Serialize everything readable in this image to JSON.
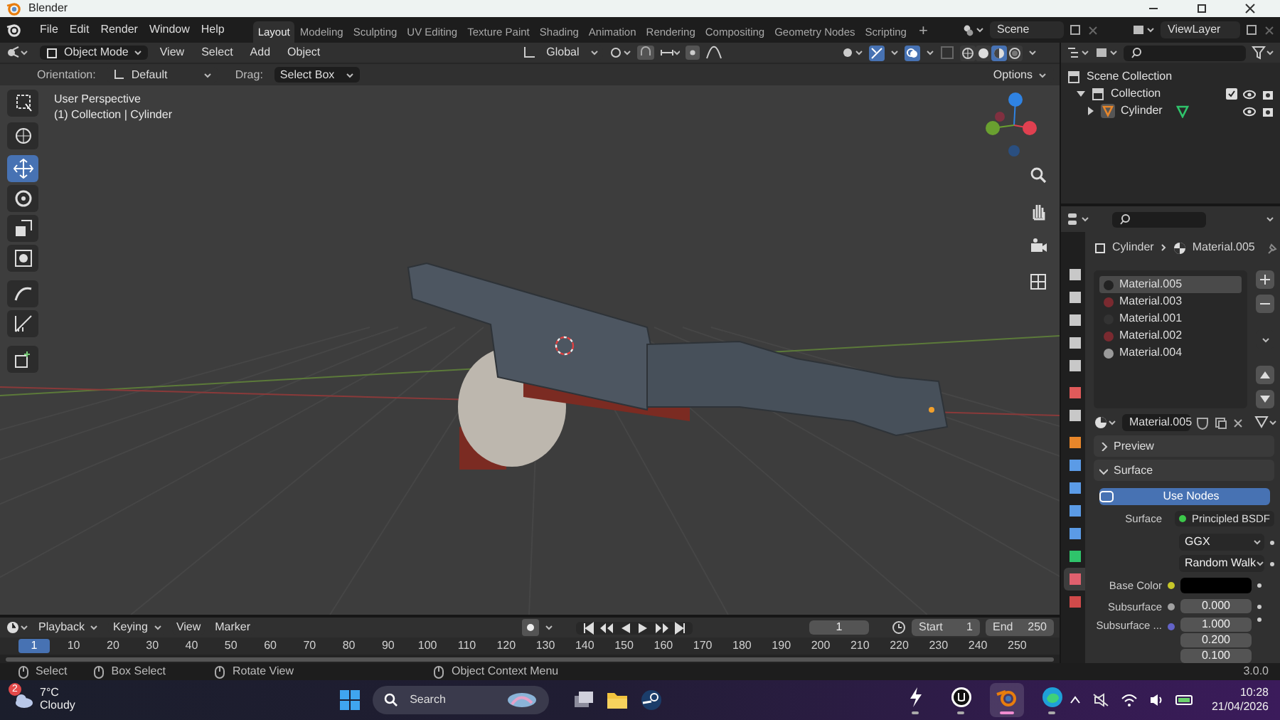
{
  "window": {
    "title": "Blender"
  },
  "menu": [
    "File",
    "Edit",
    "Render",
    "Window",
    "Help"
  ],
  "workspaces": [
    {
      "label": "Layout",
      "selected": true
    },
    {
      "label": "Modeling",
      "selected": false
    },
    {
      "label": "Sculpting",
      "selected": false
    },
    {
      "label": "UV Editing",
      "selected": false
    },
    {
      "label": "Texture Paint",
      "selected": false
    },
    {
      "label": "Shading",
      "selected": false
    },
    {
      "label": "Animation",
      "selected": false
    },
    {
      "label": "Rendering",
      "selected": false
    },
    {
      "label": "Compositing",
      "selected": false
    },
    {
      "label": "Geometry Nodes",
      "selected": false
    },
    {
      "label": "Scripting",
      "selected": false
    }
  ],
  "add_workspace": "+",
  "scene": "Scene",
  "view_layer": "ViewLayer",
  "viewport": {
    "mode": "Object Mode",
    "menus": [
      "View",
      "Select",
      "Add",
      "Object"
    ],
    "transform_orientation": "Global",
    "tool_settings": [
      {
        "label": "Orientation:",
        "value": "Default"
      },
      {
        "label": "Drag:",
        "value": "Select Box"
      }
    ],
    "options": "Options",
    "view_name": "User Perspective",
    "context": "(1) Collection | Cylinder",
    "tools": [
      {
        "selected": false
      },
      {
        "selected": false
      },
      {
        "selected": true
      },
      {
        "selected": false
      },
      {
        "selected": false
      },
      {
        "selected": false
      },
      {
        "selected": false
      },
      {
        "selected": false
      },
      {
        "selected": false
      }
    ],
    "shading_modes": [
      {
        "selected": false
      },
      {
        "selected": false
      },
      {
        "selected": true
      },
      {
        "selected": false
      }
    ]
  },
  "outliner": {
    "tree": [
      {
        "label": "Scene Collection",
        "children": [
          {
            "label": "Collection",
            "expanded": true,
            "children": [
              {
                "label": "Cylinder",
                "expanded": false
              }
            ]
          }
        ]
      }
    ]
  },
  "properties": {
    "tabs": [
      {
        "color": "#c8c8c8",
        "selected": false
      },
      {
        "color": "#c8c8c8",
        "selected": false
      },
      {
        "color": "#c8c8c8",
        "selected": false
      },
      {
        "color": "#c8c8c8",
        "selected": false
      },
      {
        "color": "#c8c8c8",
        "selected": false
      },
      {
        "color": "#e05a5a",
        "selected": false
      },
      {
        "color": "#c8c8c8",
        "selected": false
      },
      {
        "color": "#e8862a",
        "selected": false
      },
      {
        "color": "#5b9be6",
        "selected": false
      },
      {
        "color": "#5b9be6",
        "selected": false
      },
      {
        "color": "#5b9be6",
        "selected": false
      },
      {
        "color": "#5b9be6",
        "selected": false
      },
      {
        "color": "#2fc46b",
        "selected": false
      },
      {
        "color": "#e0606e",
        "selected": true
      },
      {
        "color": "#d04a4a",
        "selected": false
      }
    ],
    "breadcrumb": [
      "Cylinder",
      "Material.005"
    ],
    "materials": [
      {
        "label": "Material.005",
        "color": "#222222",
        "selected": true
      },
      {
        "label": "Material.003",
        "color": "#7a2a30",
        "selected": false
      },
      {
        "label": "Material.001",
        "color": "#333333",
        "selected": false
      },
      {
        "label": "Material.002",
        "color": "#7a2a30",
        "selected": false
      },
      {
        "label": "Material.004",
        "color": "#9a9a9a",
        "selected": false
      }
    ],
    "material_name": "Material.005",
    "panels": [
      {
        "label": "Preview",
        "expanded": false
      },
      {
        "label": "Surface",
        "expanded": true
      }
    ],
    "use_nodes": "Use Nodes",
    "fields": [
      {
        "kind": "link",
        "label": "Surface",
        "value": "Principled BSDF"
      },
      {
        "kind": "dropdown",
        "value": "GGX"
      },
      {
        "kind": "dropdown",
        "value": "Random Walk"
      },
      {
        "kind": "swatch",
        "label": "Base Color",
        "color": "#000000"
      },
      {
        "kind": "number",
        "label": "Subsurface",
        "value": "0.000"
      },
      {
        "kind": "vector",
        "label": "Subsurface ...",
        "values": [
          "1.000",
          "0.200",
          "0.100"
        ]
      }
    ]
  },
  "timeline": {
    "menus": [
      "Playback",
      "Keying",
      "View",
      "Marker"
    ],
    "current_frame": "1",
    "start_label": "Start",
    "start": "1",
    "end_label": "End",
    "end": "250",
    "ruler": [
      {
        "label": "1",
        "selected": true
      },
      {
        "label": "10",
        "selected": false
      },
      {
        "label": "20",
        "selected": false
      },
      {
        "label": "30",
        "selected": false
      },
      {
        "label": "40",
        "selected": false
      },
      {
        "label": "50",
        "selected": false
      },
      {
        "label": "60",
        "selected": false
      },
      {
        "label": "70",
        "selected": false
      },
      {
        "label": "80",
        "selected": false
      },
      {
        "label": "90",
        "selected": false
      },
      {
        "label": "100",
        "selected": false
      },
      {
        "label": "110",
        "selected": false
      },
      {
        "label": "120",
        "selected": false
      },
      {
        "label": "130",
        "selected": false
      },
      {
        "label": "140",
        "selected": false
      },
      {
        "label": "150",
        "selected": false
      },
      {
        "label": "160",
        "selected": false
      },
      {
        "label": "170",
        "selected": false
      },
      {
        "label": "180",
        "selected": false
      },
      {
        "label": "190",
        "selected": false
      },
      {
        "label": "200",
        "selected": false
      },
      {
        "label": "210",
        "selected": false
      },
      {
        "label": "220",
        "selected": false
      },
      {
        "label": "230",
        "selected": false
      },
      {
        "label": "240",
        "selected": false
      },
      {
        "label": "250",
        "selected": false
      }
    ]
  },
  "status_bar": {
    "hints": [
      "Select",
      "Box Select",
      "Rotate View",
      "Object Context Menu"
    ],
    "version": "3.0.0"
  },
  "taskbar": {
    "temperature": "7°C",
    "condition": "Cloudy",
    "badge": "2",
    "search": {
      "placeholder": "Search"
    },
    "apps": [
      {
        "kind": "bolt",
        "running": true,
        "selected": false
      },
      {
        "kind": "unreal",
        "running": true,
        "selected": false
      },
      {
        "kind": "blender",
        "running": true,
        "selected": true
      },
      {
        "kind": "edge",
        "running": true,
        "selected": false
      }
    ],
    "time": "10:28",
    "date": "21/04/2026"
  }
}
